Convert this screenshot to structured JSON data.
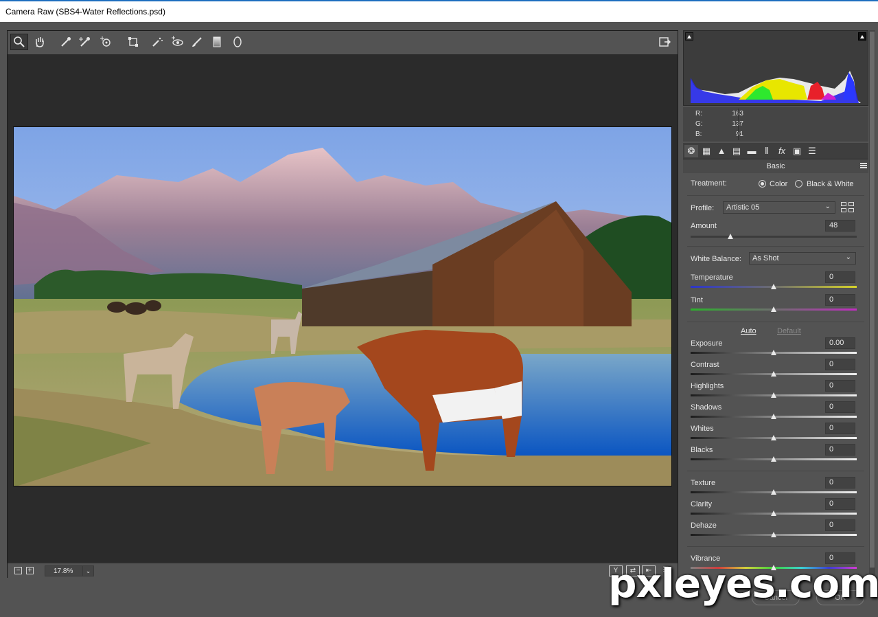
{
  "window": {
    "title": "Camera Raw (SBS4-Water Reflections.psd)"
  },
  "toolbar": {
    "tools": [
      {
        "name": "zoom-tool",
        "glyph": "⚲"
      },
      {
        "name": "hand-tool",
        "glyph": "✋"
      },
      {
        "name": "white-balance-tool",
        "glyph": "✎"
      },
      {
        "name": "color-sampler-tool",
        "glyph": "✎"
      },
      {
        "name": "targeted-adjustment-tool",
        "glyph": "◎"
      },
      {
        "name": "transform-tool",
        "glyph": "⌗"
      },
      {
        "name": "spot-removal-tool",
        "glyph": "✐"
      },
      {
        "name": "red-eye-tool",
        "glyph": "◉"
      },
      {
        "name": "adjustment-brush-tool",
        "glyph": "🖌"
      },
      {
        "name": "graduated-filter-tool",
        "glyph": "▯"
      },
      {
        "name": "radial-filter-tool",
        "glyph": "◯"
      }
    ]
  },
  "canvas": {
    "zoom": "17.8%",
    "zoom_out": "−",
    "zoom_in": "+",
    "view_btns": [
      "Y",
      "⇄",
      "⇤",
      "☰"
    ]
  },
  "readout": {
    "r_label": "R:",
    "r": "163",
    "g_label": "G:",
    "g": "137",
    "b_label": "B:",
    "b": "91"
  },
  "panel": {
    "title": "Basic",
    "treatment_label": "Treatment:",
    "treatment_color": "Color",
    "treatment_bw": "Black & White",
    "profile_label": "Profile:",
    "profile_value": "Artistic 05",
    "amount_label": "Amount",
    "amount_value": "48",
    "amount_pos": 0.24,
    "wb_label": "White Balance:",
    "wb_value": "As Shot",
    "auto": "Auto",
    "default": "Default",
    "sliders": [
      {
        "key": "temperature",
        "label": "Temperature",
        "value": "0"
      },
      {
        "key": "tint",
        "label": "Tint",
        "value": "0"
      },
      {
        "key": "exposure",
        "label": "Exposure",
        "value": "0.00"
      },
      {
        "key": "contrast",
        "label": "Contrast",
        "value": "0"
      },
      {
        "key": "highlights",
        "label": "Highlights",
        "value": "0"
      },
      {
        "key": "shadows",
        "label": "Shadows",
        "value": "0"
      },
      {
        "key": "whites",
        "label": "Whites",
        "value": "0"
      },
      {
        "key": "blacks",
        "label": "Blacks",
        "value": "0"
      },
      {
        "key": "texture",
        "label": "Texture",
        "value": "0"
      },
      {
        "key": "clarity",
        "label": "Clarity",
        "value": "0"
      },
      {
        "key": "dehaze",
        "label": "Dehaze",
        "value": "0"
      },
      {
        "key": "vibrance",
        "label": "Vibrance",
        "value": "0"
      }
    ]
  },
  "footer": {
    "cancel": "Cancel",
    "ok": "OK"
  },
  "watermark": "pxleyes.com",
  "colors": {
    "panel": "#535353",
    "canvas": "#2b2b2b",
    "accent": "#1e6fbf"
  }
}
